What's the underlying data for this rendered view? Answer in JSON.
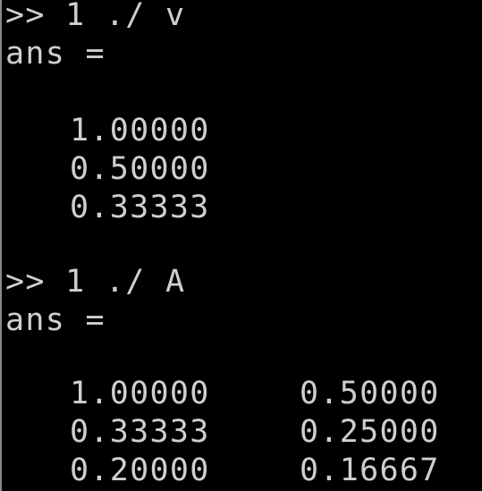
{
  "colors": {
    "background": "#000000",
    "text": "#cfcfcf"
  },
  "terminal": {
    "cmd1": ">> 1 ./ v",
    "ans1": "ans =",
    "v_result": [
      "1.00000",
      "0.50000",
      "0.33333"
    ],
    "cmd2": ">> 1 ./ A",
    "ans2": "ans =",
    "A_result": [
      [
        "1.00000",
        "0.50000"
      ],
      [
        "0.33333",
        "0.25000"
      ],
      [
        "0.20000",
        "0.16667"
      ]
    ]
  }
}
